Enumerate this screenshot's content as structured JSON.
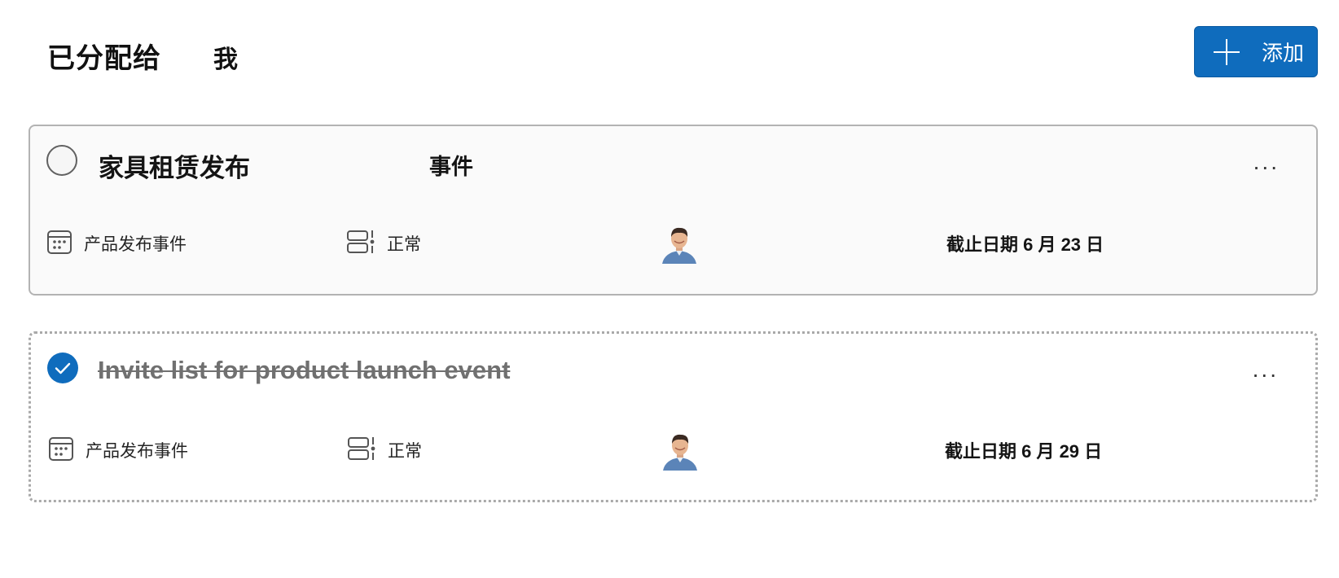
{
  "header": {
    "title": "已分配给",
    "assignee": "我",
    "add_button_label": "添加"
  },
  "tasks": [
    {
      "title": "家具租赁发布",
      "tag": "事件",
      "completed": false,
      "more_label": "...",
      "bucket": "产品发布事件",
      "priority": "正常",
      "due": "截止日期 6 月 23 日"
    },
    {
      "title": "Invite list for product launch event",
      "completed": true,
      "more_label": "...",
      "bucket": "产品发布事件",
      "priority": "正常",
      "due": "截止日期 6 月 29 日"
    }
  ],
  "colors": {
    "accent": "#0f6cbd",
    "card_border": "#b3b3b3",
    "completed_title": "#707070"
  },
  "icons": {
    "add": "plus-icon",
    "check_empty": "circle-icon",
    "check_done": "checkmark-icon",
    "bucket": "calendar-icon",
    "priority": "priority-layout-icon",
    "more": "more-horizontal-icon",
    "assignee": "avatar"
  }
}
